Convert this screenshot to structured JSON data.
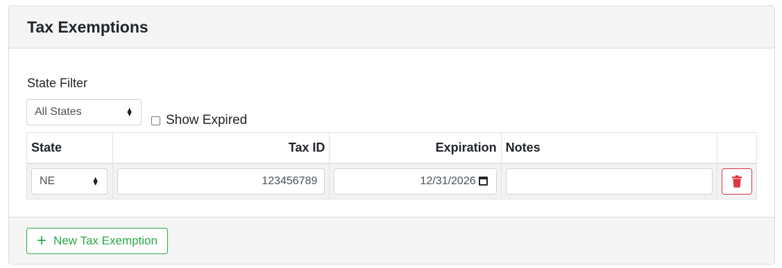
{
  "card": {
    "title": "Tax Exemptions"
  },
  "filter": {
    "label": "State Filter",
    "selected": "All States",
    "show_expired_label": "Show Expired"
  },
  "table": {
    "headers": {
      "state": "State",
      "tax_id": "Tax ID",
      "expiration": "Expiration",
      "notes": "Notes"
    },
    "rows": [
      {
        "state": "NE",
        "tax_id": "123456789",
        "expiration": "12/31/2026",
        "notes": ""
      }
    ]
  },
  "footer": {
    "new_button_label": "New Tax Exemption"
  },
  "icons": {
    "delete": "trash-icon",
    "add": "plus-icon",
    "calendar": "calendar-icon"
  },
  "colors": {
    "danger": "#dc3545",
    "success": "#28a745"
  }
}
